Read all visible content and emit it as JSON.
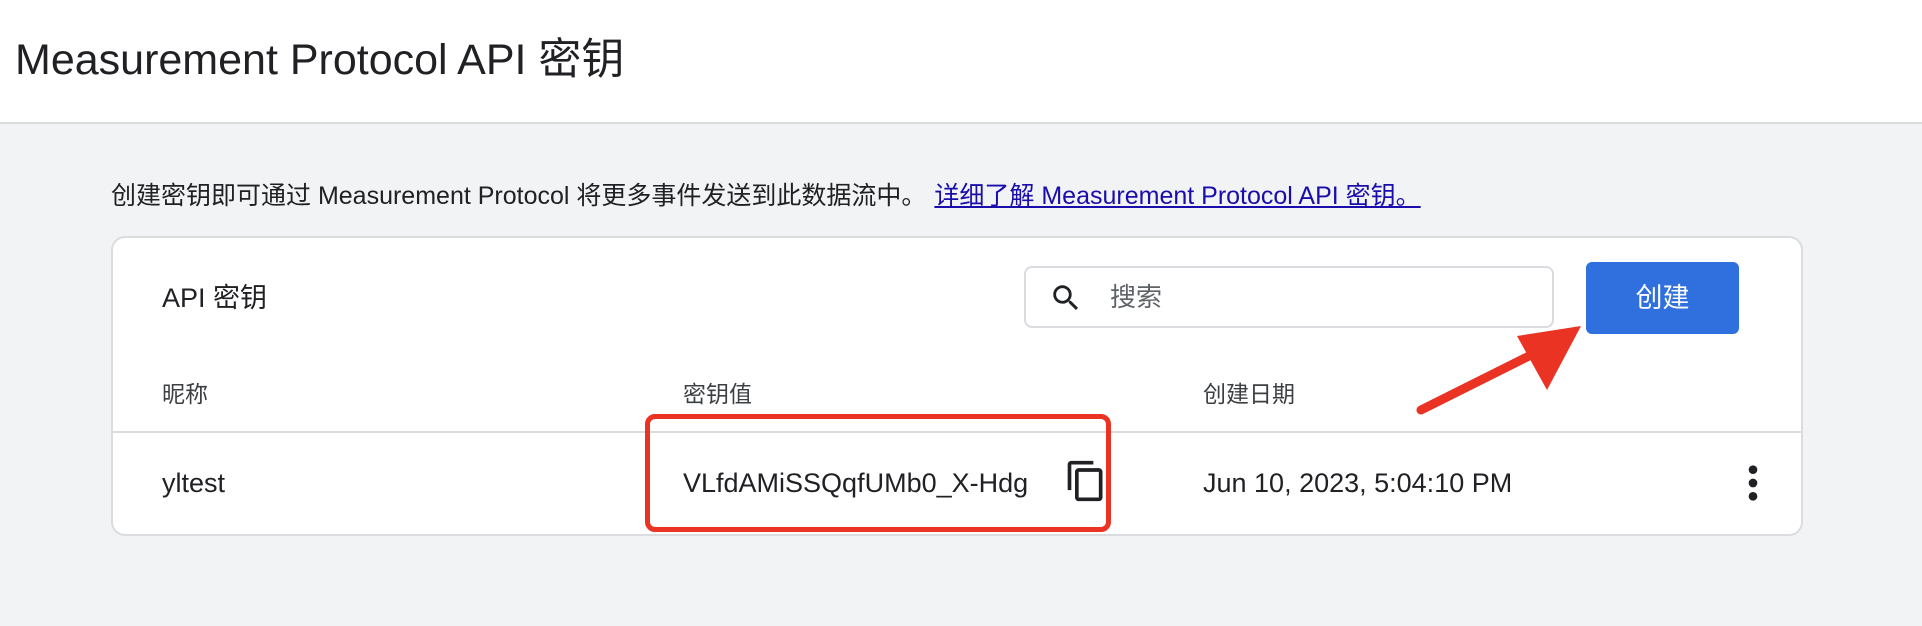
{
  "header": {
    "title": "Measurement Protocol API 密钥"
  },
  "intro": {
    "text": "创建密钥即可通过 Measurement Protocol 将更多事件发送到此数据流中。",
    "link_text": "详细了解 Measurement Protocol API 密钥。"
  },
  "card": {
    "title": "API 密钥",
    "search": {
      "placeholder": "搜索",
      "value": ""
    },
    "create_label": "创建",
    "columns": {
      "nickname": "昵称",
      "key_value": "密钥值",
      "created": "创建日期"
    },
    "rows": [
      {
        "nickname": "yltest",
        "key_value": "VLfdAMiSSQqfUMb0_X-Hdg",
        "created": "Jun 10, 2023, 5:04:10 PM"
      }
    ]
  },
  "icons": {
    "search": "search-icon",
    "copy": "copy-icon",
    "more": "more-vert-icon"
  },
  "colors": {
    "primary_button": "#2f6fde",
    "link": "#1a0dab",
    "annotation": "#ea3323",
    "background": "#f1f3f4"
  }
}
